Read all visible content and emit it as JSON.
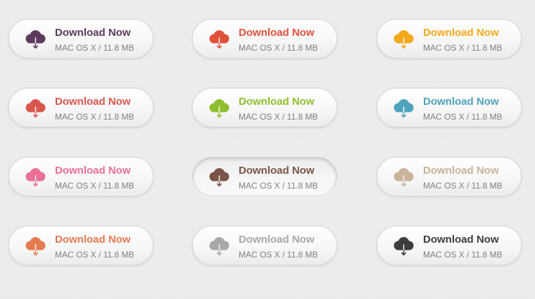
{
  "buttons": [
    {
      "title": "Download Now",
      "subtitle": "MAC OS X / 11.8 MB",
      "color": "#5b3a5e",
      "pressed": false
    },
    {
      "title": "Download Now",
      "subtitle": "MAC OS X / 11.8 MB",
      "color": "#e0513a",
      "pressed": false
    },
    {
      "title": "Download Now",
      "subtitle": "MAC OS X / 11.8 MB",
      "color": "#f4a91c",
      "pressed": false
    },
    {
      "title": "Download Now",
      "subtitle": "MAC OS X / 11.8 MB",
      "color": "#d9574f",
      "pressed": false
    },
    {
      "title": "Download Now",
      "subtitle": "MAC OS X / 11.8 MB",
      "color": "#8fbf2e",
      "pressed": false
    },
    {
      "title": "Download Now",
      "subtitle": "MAC OS X / 11.8 MB",
      "color": "#4ea3bd",
      "pressed": false
    },
    {
      "title": "Download Now",
      "subtitle": "MAC OS X / 11.8 MB",
      "color": "#ea6f94",
      "pressed": false
    },
    {
      "title": "Download Now",
      "subtitle": "MAC OS X / 11.8 MB",
      "color": "#7a5446",
      "pressed": true
    },
    {
      "title": "Download Now",
      "subtitle": "MAC OS X / 11.8 MB",
      "color": "#c9b39b",
      "pressed": false
    },
    {
      "title": "Download Now",
      "subtitle": "MAC OS X / 11.8 MB",
      "color": "#e47b4f",
      "pressed": false
    },
    {
      "title": "Download Now",
      "subtitle": "MAC OS X / 11.8 MB",
      "color": "#a8a8a8",
      "pressed": false
    },
    {
      "title": "Download Now",
      "subtitle": "MAC OS X / 11.8 MB",
      "color": "#3c3c3c",
      "pressed": false
    }
  ],
  "icon": "cloud-download-icon"
}
